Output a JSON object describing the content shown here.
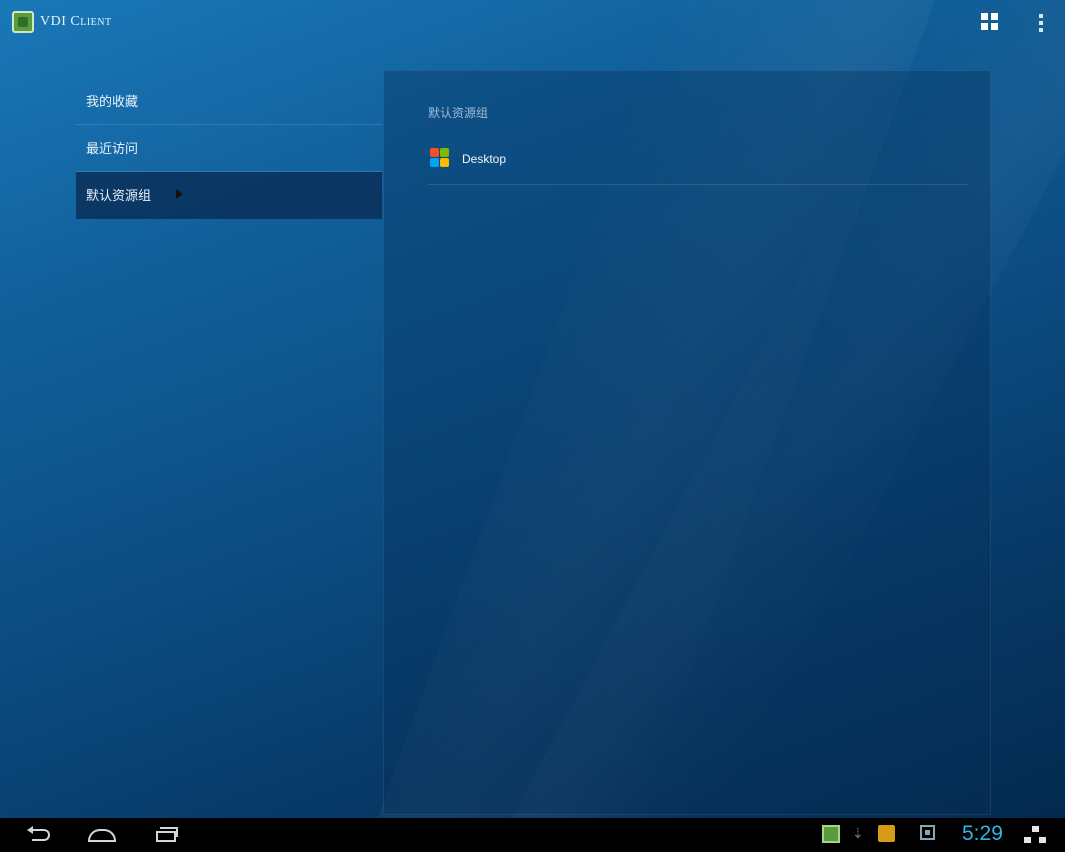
{
  "app": {
    "title": "VDI Client",
    "logo_icon": "vdi-client-logo-icon",
    "actions": [
      {
        "name": "grid-view",
        "icon": "grid-icon"
      },
      {
        "name": "overflow-menu",
        "icon": "vertical-dots-icon"
      }
    ]
  },
  "sidebar": {
    "items": [
      {
        "label": "我的收藏",
        "active": false
      },
      {
        "label": "最近访问",
        "active": false
      },
      {
        "label": "默认资源组",
        "active": true
      }
    ]
  },
  "main": {
    "heading": "默认资源组",
    "resources": [
      {
        "label": "Desktop",
        "icon": "windows-logo-icon"
      }
    ]
  },
  "system_bar": {
    "nav_buttons": [
      "back-icon",
      "home-icon",
      "recent-apps-icon"
    ],
    "tray_icons": [
      "vdi-client-notification-icon",
      "download-icon",
      "notes-icon",
      "screenshot-icon",
      "network-icon"
    ],
    "clock": "5:29"
  },
  "colors": {
    "background_top": "#1a78b8",
    "background_bottom": "#04284d",
    "active_item": "#0a2850",
    "clock": "#31b6e7"
  }
}
